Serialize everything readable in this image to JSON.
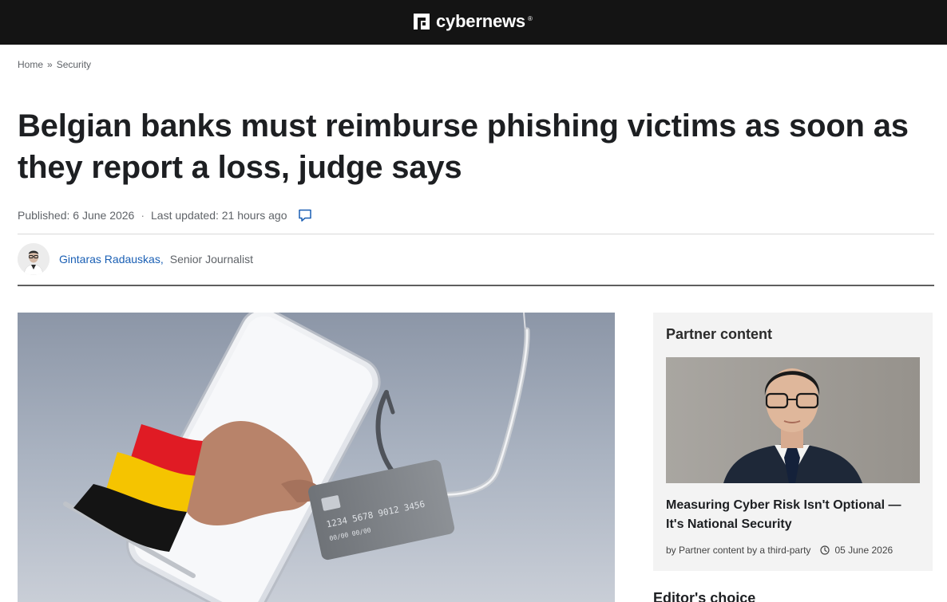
{
  "header": {
    "brand": "cybernews",
    "registered_mark": "®"
  },
  "breadcrumb": {
    "items": [
      "Home",
      "Security"
    ],
    "separator": "»"
  },
  "article": {
    "title": "Belgian banks must reimburse phishing victims as soon as they report a loss, judge says",
    "published": "Published: 6 June 2026",
    "updated": "Last updated: 21 hours ago",
    "meta_separator": "·",
    "author_name": "Gintaras Radauskas,",
    "author_role": "Senior Journalist",
    "hero_alt": "Hand holding a credit card with a Belgian flag sleeve, phone and fishing hook"
  },
  "sidebar": {
    "partner_heading": "Partner content",
    "partner_title": "Measuring Cyber Risk Isn't Optional — It's National Security",
    "partner_byline": "by Partner content by a third-party",
    "partner_date": "05 June 2026",
    "editors_heading": "Editor's choice"
  },
  "icons": {
    "logo": "cybernews-logo-icon",
    "comment": "comment-icon",
    "clock": "clock-icon"
  },
  "colors": {
    "topbar": "#141414",
    "link": "#1a5fb4",
    "sidebar_bg": "#f3f3f3"
  }
}
